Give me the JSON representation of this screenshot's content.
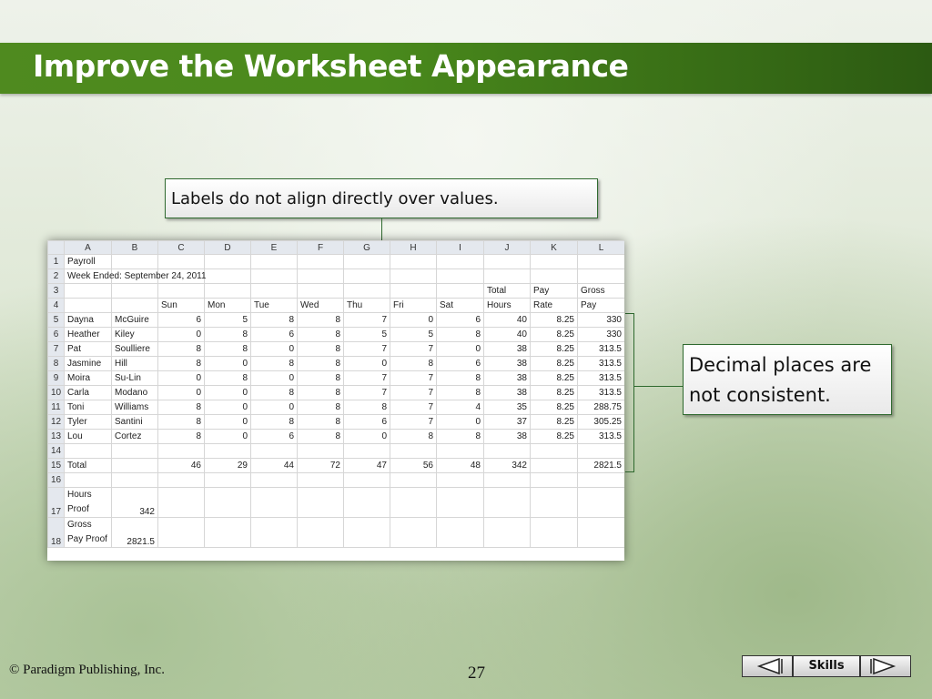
{
  "slide": {
    "title": "Improve the Worksheet Appearance",
    "callout_top": "Labels do not align directly over values.",
    "callout_right": "Decimal places are not consistent.",
    "page_number": "27",
    "copyright": "© Paradigm Publishing, Inc.",
    "nav": {
      "skills_label": "Skills",
      "prev_icon": "left-triangle-icon",
      "next_icon": "right-triangle-icon"
    }
  },
  "sheet": {
    "columns": [
      "",
      "A",
      "B",
      "C",
      "D",
      "E",
      "F",
      "G",
      "H",
      "I",
      "J",
      "K",
      "L"
    ],
    "rows": [
      [
        "1",
        "Payroll",
        "",
        "",
        "",
        "",
        "",
        "",
        "",
        "",
        "",
        "",
        ""
      ],
      [
        "2",
        "Week Ended: September 24, 2011",
        "",
        "",
        "",
        "",
        "",
        "",
        "",
        "",
        "",
        "",
        ""
      ],
      [
        "3",
        "",
        "",
        "",
        "",
        "",
        "",
        "",
        "",
        "",
        "Total",
        "Pay",
        "Gross"
      ],
      [
        "4",
        "",
        "",
        "Sun",
        "Mon",
        "Tue",
        "Wed",
        "Thu",
        "Fri",
        "Sat",
        "Hours",
        "Rate",
        "Pay"
      ],
      [
        "5",
        "Dayna",
        "McGuire",
        "6",
        "5",
        "8",
        "8",
        "7",
        "0",
        "6",
        "40",
        "8.25",
        "330"
      ],
      [
        "6",
        "Heather",
        "Kiley",
        "0",
        "8",
        "6",
        "8",
        "5",
        "5",
        "8",
        "40",
        "8.25",
        "330"
      ],
      [
        "7",
        "Pat",
        "Soulliere",
        "8",
        "8",
        "0",
        "8",
        "7",
        "7",
        "0",
        "38",
        "8.25",
        "313.5"
      ],
      [
        "8",
        "Jasmine",
        "Hill",
        "8",
        "0",
        "8",
        "8",
        "0",
        "8",
        "6",
        "38",
        "8.25",
        "313.5"
      ],
      [
        "9",
        "Moira",
        "Su-Lin",
        "0",
        "8",
        "0",
        "8",
        "7",
        "7",
        "8",
        "38",
        "8.25",
        "313.5"
      ],
      [
        "10",
        "Carla",
        "Modano",
        "0",
        "0",
        "8",
        "8",
        "7",
        "7",
        "8",
        "38",
        "8.25",
        "313.5"
      ],
      [
        "11",
        "Toni",
        "Williams",
        "8",
        "0",
        "0",
        "8",
        "8",
        "7",
        "4",
        "35",
        "8.25",
        "288.75"
      ],
      [
        "12",
        "Tyler",
        "Santini",
        "8",
        "0",
        "8",
        "8",
        "6",
        "7",
        "0",
        "37",
        "8.25",
        "305.25"
      ],
      [
        "13",
        "Lou",
        "Cortez",
        "8",
        "0",
        "6",
        "8",
        "0",
        "8",
        "8",
        "38",
        "8.25",
        "313.5"
      ],
      [
        "14",
        "",
        "",
        "",
        "",
        "",
        "",
        "",
        "",
        "",
        "",
        "",
        ""
      ],
      [
        "15",
        "Total",
        "",
        "46",
        "29",
        "44",
        "72",
        "47",
        "56",
        "48",
        "342",
        "",
        "2821.5"
      ],
      [
        "16",
        "",
        "",
        "",
        "",
        "",
        "",
        "",
        "",
        "",
        "",
        "",
        ""
      ],
      [
        "17",
        "Hours Proof",
        "342",
        "",
        "",
        "",
        "",
        "",
        "",
        "",
        "",
        "",
        ""
      ],
      [
        "18",
        "Gross Pay Proof",
        "2821.5",
        "",
        "",
        "",
        "",
        "",
        "",
        "",
        "",
        "",
        ""
      ]
    ]
  }
}
